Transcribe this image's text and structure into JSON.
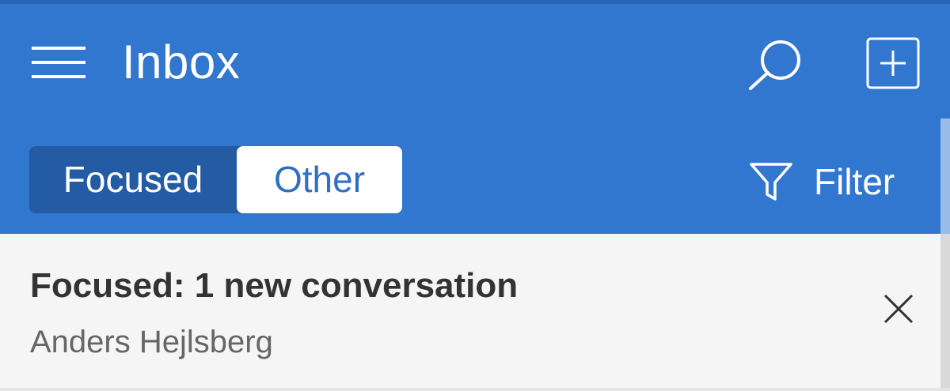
{
  "header": {
    "title": "Inbox",
    "menu_icon": "hamburger-menu-icon",
    "search_icon": "search-icon",
    "compose_icon": "compose-plus-icon",
    "background_color": "#3277cf"
  },
  "tabs": [
    {
      "label": "Focused",
      "selected": false
    },
    {
      "label": "Other",
      "selected": true
    }
  ],
  "filter": {
    "label": "Filter",
    "icon": "funnel-icon"
  },
  "notice": {
    "title": "Focused: 1 new conversation",
    "sender": "Anders Hejlsberg",
    "close_icon": "close-icon"
  },
  "colors": {
    "accent": "#3277cf",
    "tab_group_background": "#235ca3",
    "selected_tab_text": "#2f6fc4"
  }
}
